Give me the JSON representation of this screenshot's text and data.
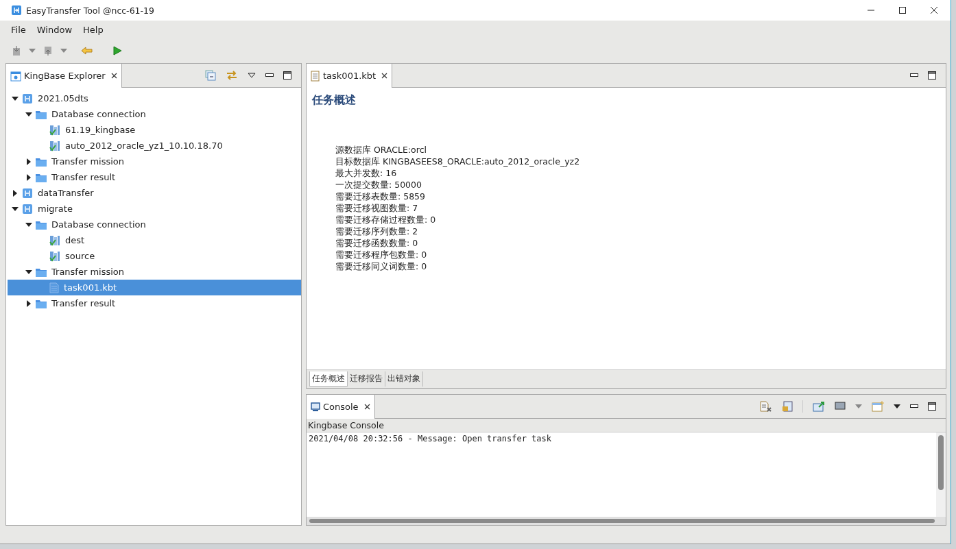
{
  "window": {
    "title": "EasyTransfer Tool @ncc-61-19"
  },
  "menu": [
    "File",
    "Window",
    "Help"
  ],
  "explorer": {
    "title": "KingBase Explorer",
    "tree": [
      {
        "label": "2021.05dts",
        "kind": "project",
        "expanded": true,
        "selected": false,
        "children": [
          {
            "label": "Database connection",
            "kind": "folder",
            "expanded": true,
            "selected": false,
            "children": [
              {
                "label": "61.19_kingbase",
                "kind": "connection",
                "selected": false
              },
              {
                "label": "auto_2012_oracle_yz1_10.10.18.70",
                "kind": "connection",
                "selected": false
              }
            ]
          },
          {
            "label": "Transfer mission",
            "kind": "folder",
            "expanded": false,
            "selected": false
          },
          {
            "label": "Transfer result",
            "kind": "folder",
            "expanded": false,
            "selected": false
          }
        ]
      },
      {
        "label": "dataTransfer",
        "kind": "project",
        "expanded": false,
        "selected": false
      },
      {
        "label": "migrate",
        "kind": "project",
        "expanded": true,
        "selected": false,
        "children": [
          {
            "label": "Database connection",
            "kind": "folder",
            "expanded": true,
            "selected": false,
            "children": [
              {
                "label": "dest",
                "kind": "connection",
                "selected": false
              },
              {
                "label": "source",
                "kind": "connection",
                "selected": false
              }
            ]
          },
          {
            "label": "Transfer mission",
            "kind": "folder",
            "expanded": true,
            "selected": false,
            "children": [
              {
                "label": "task001.kbt",
                "kind": "file",
                "selected": true
              }
            ]
          },
          {
            "label": "Transfer result",
            "kind": "folder",
            "expanded": false,
            "selected": false
          }
        ]
      }
    ]
  },
  "editor": {
    "tab": "task001.kbt",
    "heading": "任务概述",
    "lines": [
      "源数据库 ORACLE:orcl",
      "目标数据库 KINGBASEES8_ORACLE:auto_2012_oracle_yz2",
      "最大并发数: 16",
      "一次提交数量: 50000",
      "需要迁移表数量: 5859",
      "需要迁移视图数量: 7",
      "需要迁移存储过程数量: 0",
      "需要迁移序列数量: 2",
      "需要迁移函数数量: 0",
      "需要迁移程序包数量: 0",
      "需要迁移同义词数量: 0"
    ],
    "bottom_tabs": [
      {
        "label": "任务概述",
        "selected": true
      },
      {
        "label": "迁移报告",
        "selected": false
      },
      {
        "label": "出错对象",
        "selected": false
      }
    ]
  },
  "console": {
    "tab": "Console",
    "name": "Kingbase Console",
    "lines": [
      "2021/04/08 20:32:56 - Message: Open transfer task"
    ]
  }
}
